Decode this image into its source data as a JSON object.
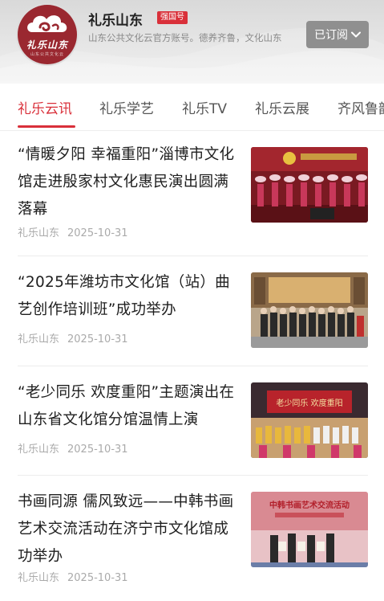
{
  "account": {
    "logo_text": "礼乐山东",
    "logo_sub": "山东公共文化云",
    "name": "礼乐山东",
    "badge": "强国号",
    "description": "山东公共文化云官方账号。德养齐鲁，文化山东",
    "subscribe_label": "已订阅"
  },
  "tabs": [
    {
      "label": "礼乐云讯",
      "active": true
    },
    {
      "label": "礼乐学艺"
    },
    {
      "label": "礼乐TV"
    },
    {
      "label": "礼乐云展"
    },
    {
      "label": "齐风鲁韵"
    }
  ],
  "articles": [
    {
      "title": "“情暖夕阳 幸福重阳”淄博市文化馆走进殷家村文化惠民演出圆满落幕",
      "source": "礼乐山东",
      "date": "2025-10-31"
    },
    {
      "title": "“2025年潍坊市文化馆（站）曲艺创作培训班”成功举办",
      "source": "礼乐山东",
      "date": "2025-10-31"
    },
    {
      "title": "“老少同乐 欢度重阳”主题演出在山东省文化馆分馆温情上演",
      "source": "礼乐山东",
      "date": "2025-10-31",
      "thumb_banner": "老少同乐 欢度重阳"
    },
    {
      "title": "书画同源 儒风致远——中韩书画艺术交流活动在济宁市文化馆成功举办",
      "source": "礼乐山东",
      "date": "2025-10-31",
      "thumb_banner": "中韩书画艺术交流活动"
    }
  ],
  "colors": {
    "accent": "#d9303a",
    "logo_bg": "#9a2830",
    "subscribe_bg": "#8f8f8f"
  }
}
